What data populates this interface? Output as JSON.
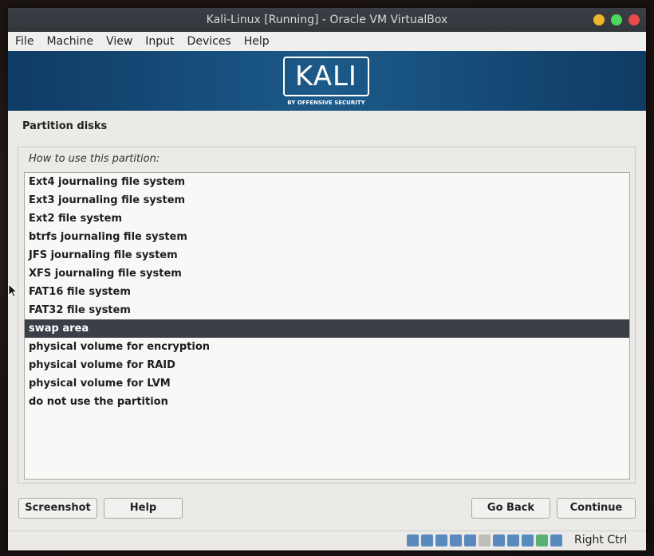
{
  "window": {
    "title": "Kali-Linux [Running] - Oracle VM VirtualBox"
  },
  "menu": [
    "File",
    "Machine",
    "View",
    "Input",
    "Devices",
    "Help"
  ],
  "banner": {
    "logo": "KALI",
    "subtitle": "BY OFFENSIVE SECURITY"
  },
  "page": {
    "title": "Partition disks",
    "question": "How to use this partition:"
  },
  "options": [
    "Ext4 journaling file system",
    "Ext3 journaling file system",
    "Ext2 file system",
    "btrfs journaling file system",
    "JFS journaling file system",
    "XFS journaling file system",
    "FAT16 file system",
    "FAT32 file system",
    "swap area",
    "physical volume for encryption",
    "physical volume for RAID",
    "physical volume for LVM",
    "do not use the partition"
  ],
  "selected_option": "swap area",
  "buttons": {
    "screenshot": "Screenshot",
    "help": "Help",
    "go_back": "Go Back",
    "continue": "Continue"
  },
  "statusbar": {
    "host_key": "Right Ctrl"
  },
  "colors": {
    "close": "#e84b4b",
    "maximize": "#4bd85a",
    "minimize": "#f0b429",
    "selection": "#3b4048",
    "banner": "#1c5a8a"
  }
}
